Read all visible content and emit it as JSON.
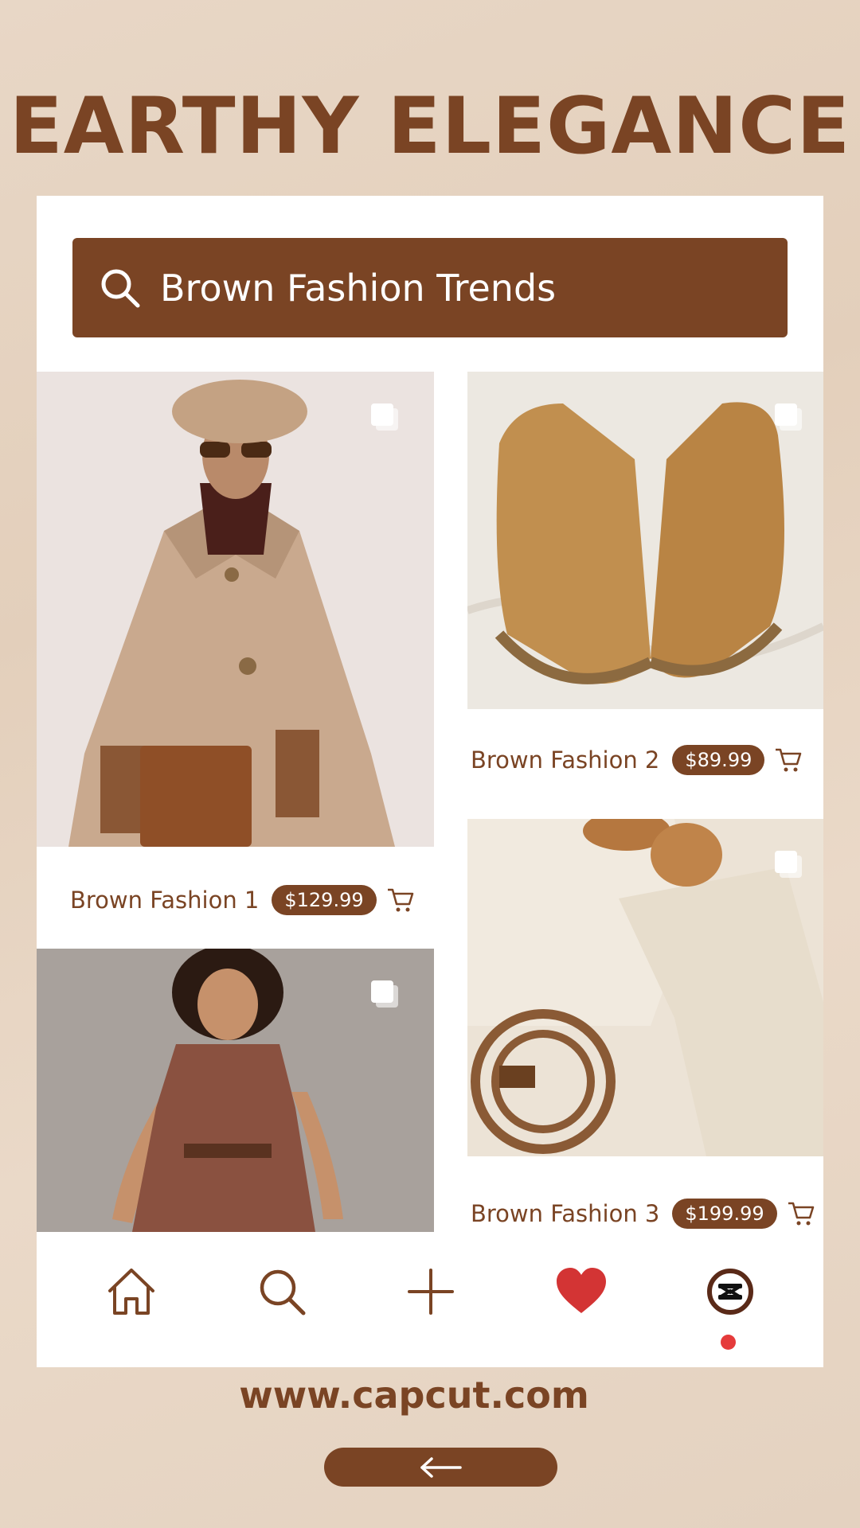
{
  "headline": "EARTHY ELEGANCE",
  "search": {
    "text": "Brown Fashion Trends",
    "icon": "search-icon"
  },
  "products": [
    {
      "name": "Brown Fashion 1",
      "price": "$129.99"
    },
    {
      "name": "Brown Fashion 2",
      "price": "$89.99"
    },
    {
      "name": "Brown Fashion 3",
      "price": "$199.99"
    }
  ],
  "nav": {
    "items": [
      "home-icon",
      "search-icon",
      "plus-icon",
      "heart-icon",
      "capcut-logo-icon"
    ],
    "notification": true
  },
  "footer": {
    "url": "www.capcut.com",
    "back_icon": "arrow-left-icon"
  },
  "colors": {
    "brand_brown": "#7a4424",
    "background": "#e8d7c6",
    "heart_red": "#d33434",
    "notification_red": "#e53b3b"
  }
}
